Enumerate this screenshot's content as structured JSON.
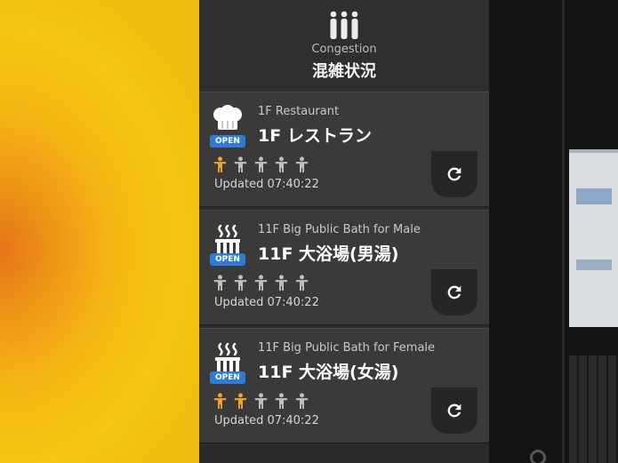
{
  "header": {
    "icon": "people-group-icon",
    "subtitle": "Congestion",
    "title": "混雑状況"
  },
  "colors": {
    "active_person": "#f0a52a",
    "inactive_person": "#bfbfbf",
    "open_badge": "#2f7bd6"
  },
  "facilities": [
    {
      "icon": "chef-hat-icon",
      "badge": "OPEN",
      "name_en": "1F Restaurant",
      "name_jp": "1F レストラン",
      "congestion_level": 1,
      "congestion_max": 5,
      "updated": "Updated 07:40:22"
    },
    {
      "icon": "hot-spring-icon",
      "badge": "OPEN",
      "name_en": "11F Big Public Bath for Male",
      "name_jp": "11F 大浴場(男湯)",
      "congestion_level": 0,
      "congestion_max": 5,
      "updated": "Updated 07:40:22"
    },
    {
      "icon": "hot-spring-icon",
      "badge": "OPEN",
      "name_en": "11F Big Public Bath for Female",
      "name_jp": "11F 大浴場(女湯)",
      "congestion_level": 2,
      "congestion_max": 5,
      "updated": "Updated 07:40:22"
    }
  ]
}
